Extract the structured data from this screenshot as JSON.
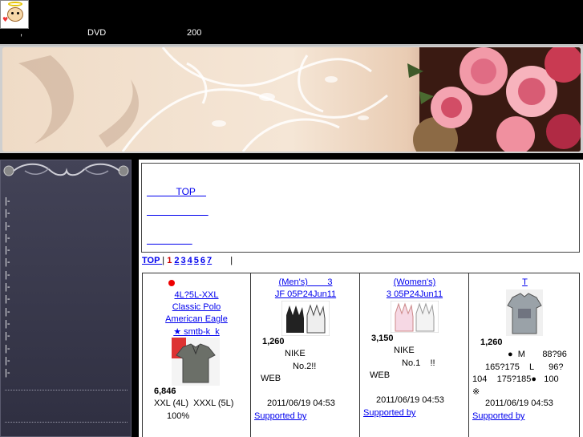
{
  "header": {
    "nav_items": [
      ",",
      "DVD",
      "200"
    ]
  },
  "sidebar": {
    "items": [
      "|-",
      "|-",
      "|-",
      "|-",
      "|-",
      "|-",
      "|-",
      "|-",
      "|-",
      "|-",
      "|-",
      "|-",
      "|-",
      "|-",
      "|-"
    ]
  },
  "notice": {
    "links": [
      "           TOP    ",
      "                       ",
      "                 "
    ]
  },
  "pager": {
    "top_label": "TOP     ",
    "separator": "|",
    "current": "1",
    "pages": [
      "2",
      "3",
      "4",
      "5",
      "6",
      "7"
    ],
    "tail_separator": "|",
    "tail_link": "     "
  },
  "products": [
    {
      "title_lines": [
        "4L?5L-XXL",
        "Classic Polo",
        "American Eagle",
        "★ smtb-k  k"
      ],
      "price": "6,846",
      "desc_lines": [
        "XXL (4L)  XXXL (5L)",
        "100%"
      ],
      "date": "",
      "supported": ""
    },
    {
      "title_lines": [
        "(Men's)        3",
        "JF 05P24Jun11"
      ],
      "price": "1,260",
      "desc_lines": [
        "NIKE",
        "No.2!!",
        "WEB"
      ],
      "date": "2011/06/19 04:53",
      "supported": "Supported by"
    },
    {
      "title_lines": [
        "(Women's)",
        "3 05P24Jun11"
      ],
      "price": "3,150",
      "desc_lines": [
        "NIKE",
        "No.1    !!",
        "WEB"
      ],
      "date": "2011/06/19 04:53",
      "supported": "Supported by"
    },
    {
      "title_lines": [
        "T"
      ],
      "price": "1,260",
      "desc_lines": [
        "●  M       88?96",
        "165?175    L      96?",
        "104    175?185●   100",
        "※"
      ],
      "date": "2011/06/19 04:53",
      "supported": "Supported by"
    }
  ]
}
